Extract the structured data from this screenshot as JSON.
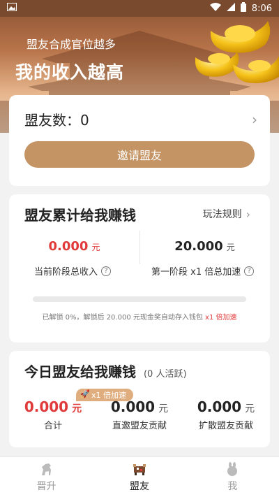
{
  "statusbar": {
    "time": "8:06"
  },
  "banner": {
    "subtitle": "盟友合成官位越多",
    "title": "我的收入越高"
  },
  "allies": {
    "label": "盟友数：0",
    "invite_button": "邀请盟友"
  },
  "earnings": {
    "title": "盟友累计给我赚钱",
    "rules_link": "玩法规则",
    "current_income_value": "0.000",
    "current_income_unit": "元",
    "current_income_label": "当前阶段总收入",
    "stage_accel_value": "20.000",
    "stage_accel_unit": "元",
    "stage_accel_label": "第一阶段 x1 倍总加速",
    "unlock_progress": 0,
    "unlock_note_prefix": "已解锁 0%，解锁后 20.000 元现金奖自动存入钱包",
    "unlock_note_accel": "x1 倍加速"
  },
  "today": {
    "title": "今日盟友给我赚钱",
    "active_note": "(0 人活跃)",
    "boost_badge": "x1 倍加速",
    "total_value": "0.000",
    "total_unit": "元",
    "total_label": "合计",
    "direct_value": "0.000",
    "direct_unit": "元",
    "direct_label": "直邀盟友贡献",
    "spread_value": "0.000",
    "spread_unit": "元",
    "spread_label": "扩散盟友贡献"
  },
  "tabs": [
    {
      "label": "晋升",
      "icon": "horse-icon"
    },
    {
      "label": "盟友",
      "icon": "cow-icon"
    },
    {
      "label": "我",
      "icon": "rabbit-icon"
    }
  ],
  "colors": {
    "accent": "#c49464",
    "red": "#e03a3a"
  }
}
